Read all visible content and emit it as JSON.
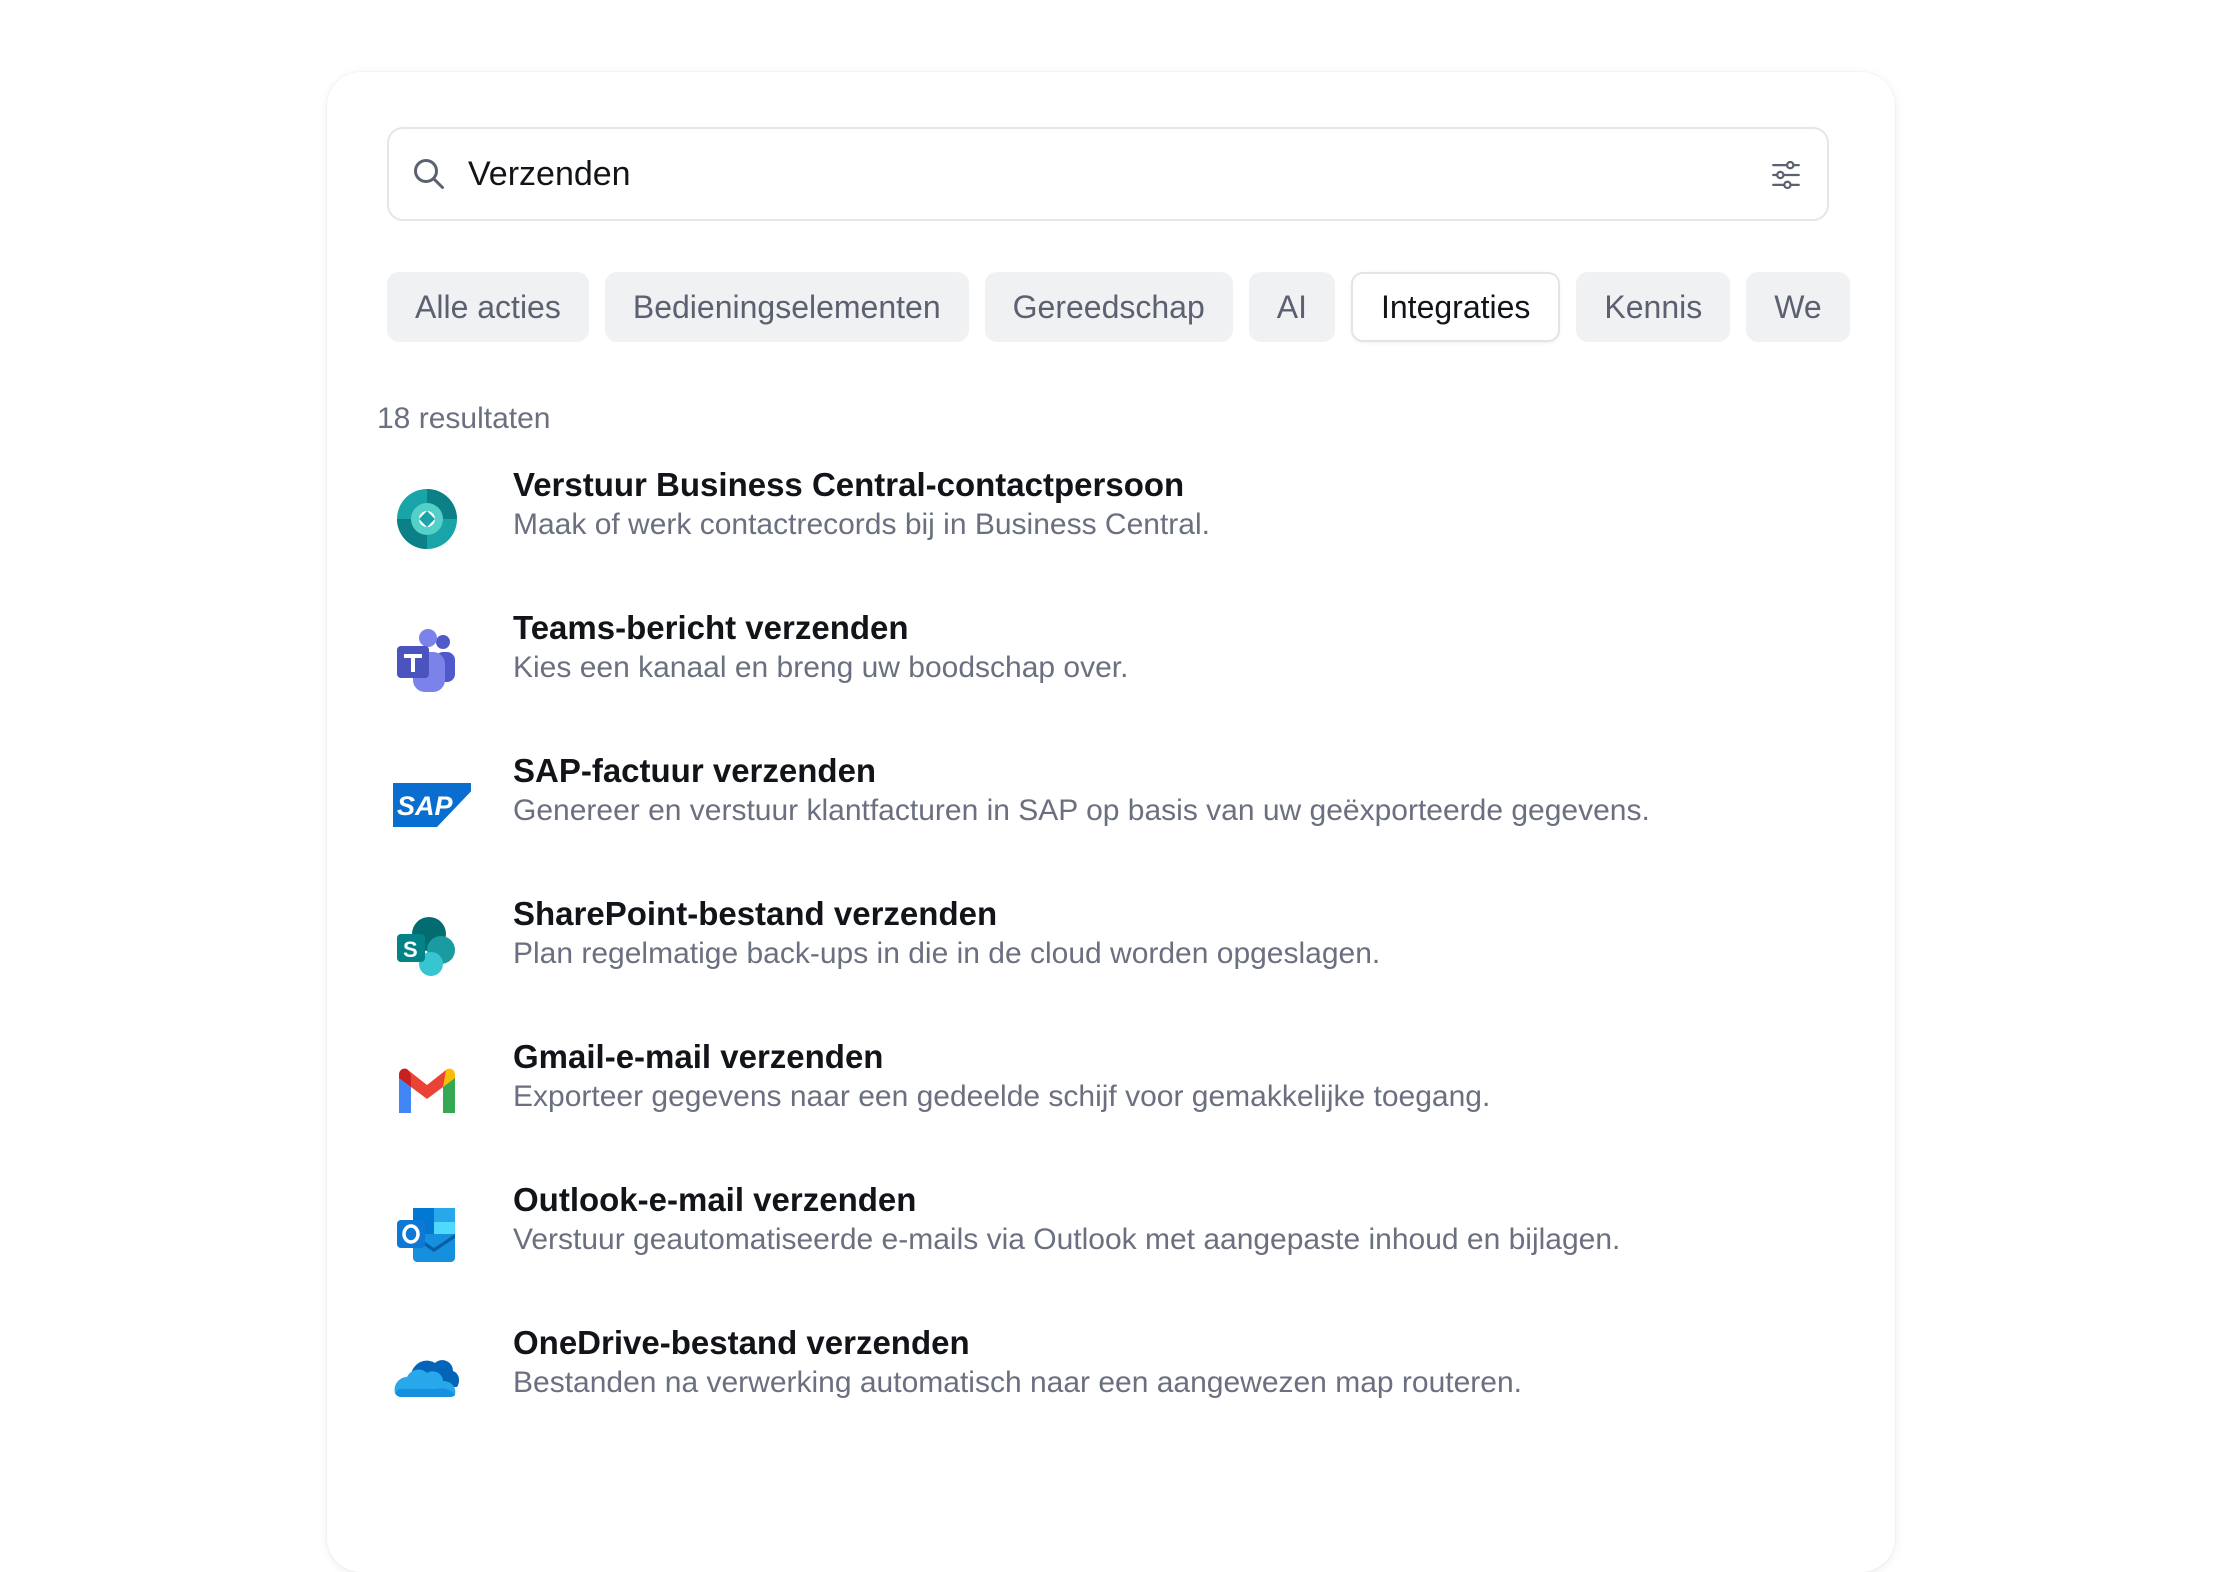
{
  "search": {
    "value": "Verzenden"
  },
  "filters": [
    {
      "label": "Alle acties",
      "active": false
    },
    {
      "label": "Bedieningselementen",
      "active": false
    },
    {
      "label": "Gereedschap",
      "active": false
    },
    {
      "label": "AI",
      "active": false
    },
    {
      "label": "Integraties",
      "active": true
    },
    {
      "label": "Kennis",
      "active": false
    },
    {
      "label": "We",
      "active": false
    }
  ],
  "results": {
    "count_label": "18 resultaten",
    "items": [
      {
        "title": "Verstuur Business Central-contactpersoon",
        "description": "Maak of werk contactrecords bij in Business Central.",
        "icon": "business-central-icon"
      },
      {
        "title": "Teams-bericht verzenden",
        "description": "Kies een kanaal en breng uw boodschap over.",
        "icon": "teams-icon"
      },
      {
        "title": "SAP-factuur verzenden",
        "description": "Genereer en verstuur klantfacturen in SAP op basis van uw geëxporteerde gegevens.",
        "icon": "sap-icon"
      },
      {
        "title": "SharePoint-bestand verzenden",
        "description": "Plan regelmatige back-ups in die in de cloud worden opgeslagen.",
        "icon": "sharepoint-icon"
      },
      {
        "title": "Gmail-e-mail verzenden",
        "description": "Exporteer gegevens naar een gedeelde schijf voor gemakkelijke toegang.",
        "icon": "gmail-icon"
      },
      {
        "title": "Outlook-e-mail verzenden",
        "description": "Verstuur geautomatiseerde e-mails via Outlook met aangepaste inhoud en bijlagen.",
        "icon": "outlook-icon"
      },
      {
        "title": "OneDrive-bestand verzenden",
        "description": "Bestanden na verwerking automatisch naar een aangewezen map routeren.",
        "icon": "onedrive-icon"
      }
    ]
  },
  "colors": {
    "title_text": "#111418",
    "secondary_text": "#6b7080",
    "chip_bg": "#f0f1f3"
  }
}
